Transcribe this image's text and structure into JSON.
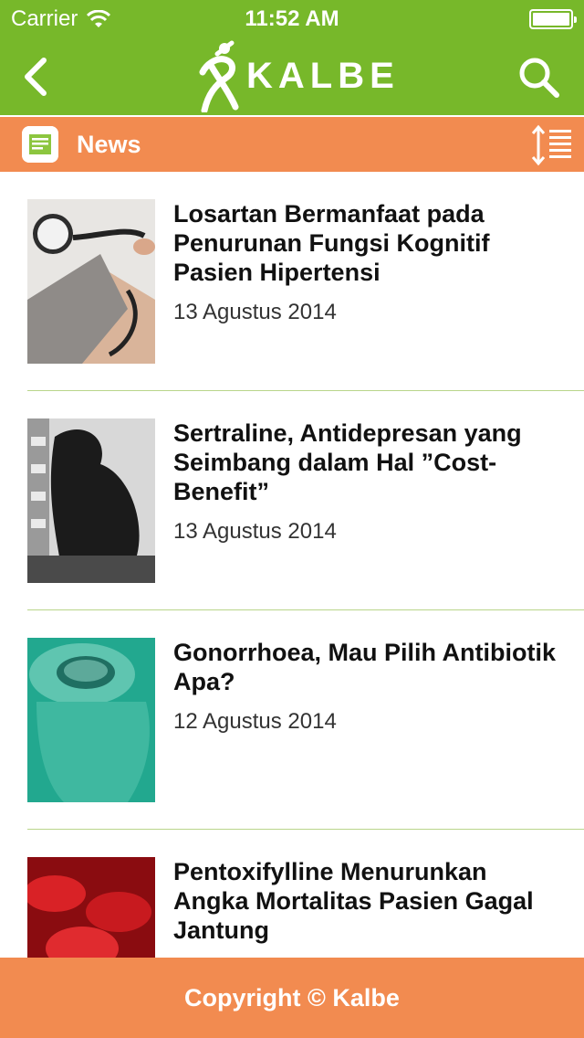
{
  "status_bar": {
    "carrier": "Carrier",
    "time": "11:52 AM",
    "battery_level": 1.0
  },
  "nav": {
    "back_icon": "chevron-left-icon",
    "logo_text": "KALBE",
    "search_icon": "search-icon"
  },
  "section": {
    "title": "News",
    "icon": "news-icon",
    "sort_icon": "sort-icon"
  },
  "articles": [
    {
      "title": "Losartan Bermanfaat pada Penurunan Fungsi Kognitif Pasien Hipertensi",
      "date": "13 Agustus 2014",
      "thumb": "blood-pressure-cuff"
    },
    {
      "title": "Sertraline, Antidepresan yang Seimbang dalam Hal ”Cost-Benefit”",
      "date": "13 Agustus 2014",
      "thumb": "depressed-person"
    },
    {
      "title": "Gonorrhoea, Mau Pilih Antibiotik Apa?",
      "date": "12 Agustus 2014",
      "thumb": "vial"
    },
    {
      "title": "Pentoxifylline Menurunkan Angka Mortalitas Pasien Gagal Jantung",
      "date": "",
      "thumb": "red-blood-cells"
    }
  ],
  "footer": {
    "text": "Copyright © Kalbe"
  },
  "colors": {
    "nav_green": "#77b82a",
    "accent_orange": "#f28b50",
    "separator": "#b9d58a"
  }
}
